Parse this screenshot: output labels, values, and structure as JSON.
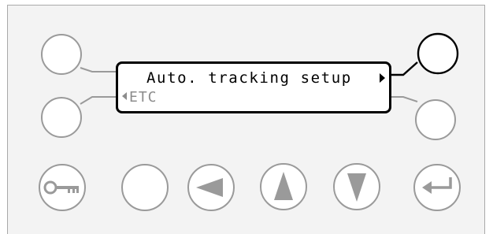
{
  "display": {
    "line1": "Auto. tracking setup",
    "line2": "ETC"
  },
  "colors": {
    "panel_background": "#f3f3f3",
    "panel_border": "#a9a9a9",
    "inactive_button": "#9a9a9a",
    "active_button": "#000000",
    "lcd_text": "#000000",
    "lcd_text_dim": "#8c8c8c"
  },
  "soft_keys": [
    {
      "name": "top-left",
      "active": false
    },
    {
      "name": "bottom-left",
      "active": false
    },
    {
      "name": "top-right",
      "active": true
    },
    {
      "name": "bottom-right",
      "active": false
    }
  ],
  "controls": [
    {
      "icon": "key-icon"
    },
    {
      "icon": "blank"
    },
    {
      "icon": "left-arrow-icon"
    },
    {
      "icon": "up-arrow-icon"
    },
    {
      "icon": "down-arrow-icon"
    },
    {
      "icon": "enter-icon"
    }
  ]
}
